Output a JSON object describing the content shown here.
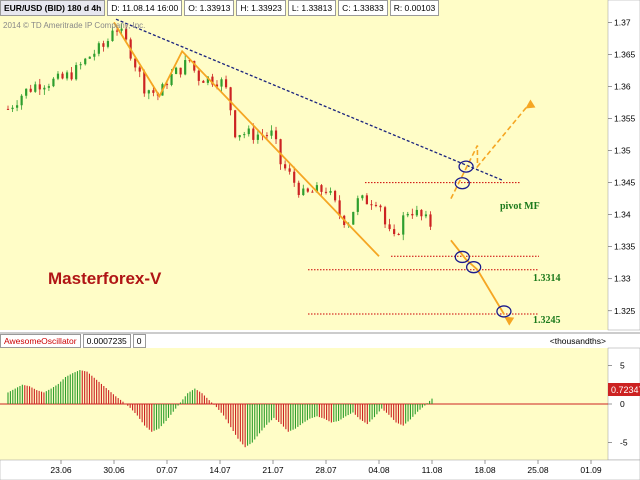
{
  "header": {
    "symbol": "EUR/USD (BID) 180 d 4h",
    "date": "D: 11.08.14 16:00",
    "open": "O: 1.33913",
    "high": "H: 1.33923",
    "low": "L: 1.33813",
    "close": "C: 1.33833",
    "range": "R: 0.00103"
  },
  "copyright": "2014 © TD Ameritrade IP Company, Inc.",
  "watermark": "Masterforex-V",
  "annotations": {
    "pivot": "pivot MF",
    "level1": "1.3314",
    "level2": "1.3245"
  },
  "colors": {
    "background": "#fffdc7",
    "bull_candle": "#2e9e2e",
    "bear_candle": "#cc2222",
    "trendline_blue": "#1a237e",
    "trend_orange": "#f5a623",
    "level_line": "#cc0000",
    "circle": "#1a1a8c",
    "watermark": "#b01515",
    "annotation_green": "#1c7a1c"
  },
  "oscillator": {
    "name": "AwesomeOscillator",
    "value": "0.0007235",
    "param": "0",
    "units": "<thousandths>",
    "current_label": "0.72347"
  },
  "chart_data": [
    {
      "type": "candlestick",
      "title": "EUR/USD (BID) 180 d 4h",
      "x": [
        "23.06",
        "30.06",
        "07.07",
        "14.07",
        "21.07",
        "28.07",
        "04.08",
        "11.08",
        "18.08",
        "25.08",
        "01.09"
      ],
      "ylim": [
        1.322,
        1.371
      ],
      "yticks": [
        "1.37",
        "1.365",
        "1.36",
        "1.355",
        "1.35",
        "1.345",
        "1.34",
        "1.335",
        "1.33",
        "1.325"
      ],
      "series": [
        {
          "kind": "close path",
          "points": [
            [
              "16.06",
              1.3565
            ],
            [
              "18.06",
              1.359
            ],
            [
              "20.06",
              1.3605
            ],
            [
              "23.06",
              1.361
            ],
            [
              "25.06",
              1.3625
            ],
            [
              "27.06",
              1.365
            ],
            [
              "29.06",
              1.3665
            ],
            [
              "30.06",
              1.37
            ],
            [
              "02.07",
              1.366
            ],
            [
              "04.07",
              1.36
            ],
            [
              "06.07",
              1.3585
            ],
            [
              "07.07",
              1.361
            ],
            [
              "09.07",
              1.363
            ],
            [
              "10.07",
              1.364
            ],
            [
              "11.07",
              1.3615
            ],
            [
              "14.07",
              1.361
            ],
            [
              "15.07",
              1.359
            ],
            [
              "16.07",
              1.353
            ],
            [
              "18.07",
              1.3525
            ],
            [
              "21.07",
              1.3525
            ],
            [
              "22.07",
              1.348
            ],
            [
              "23.07",
              1.3465
            ],
            [
              "25.07",
              1.343
            ],
            [
              "28.07",
              1.344
            ],
            [
              "29.07",
              1.342
            ],
            [
              "30.07",
              1.3395
            ],
            [
              "31.07",
              1.339
            ],
            [
              "01.08",
              1.342
            ],
            [
              "04.08",
              1.3425
            ],
            [
              "05.08",
              1.3375
            ],
            [
              "06.08",
              1.336
            ],
            [
              "07.08",
              1.339
            ],
            [
              "08.08",
              1.341
            ],
            [
              "11.08",
              1.3383
            ]
          ]
        }
      ],
      "levels": [
        {
          "value": 1.345,
          "label": "pivot MF"
        },
        {
          "value": 1.3314,
          "label": "1.3314"
        },
        {
          "value": 1.3245,
          "label": "1.3245"
        }
      ],
      "annotations": [
        "Masterforex-V",
        "pivot MF",
        "1.3314",
        "1.3245"
      ]
    },
    {
      "type": "bar",
      "title": "AwesomeOscillator",
      "ylim": [
        -7,
        7
      ],
      "yticks": [
        "5",
        "0",
        "-5"
      ],
      "current": 0.72347,
      "series": [
        {
          "name": "AwesomeOscillator",
          "values": [
            1.5,
            2.0,
            2.5,
            2.3,
            1.8,
            1.5,
            2.0,
            2.6,
            3.5,
            4.0,
            4.4,
            4.2,
            3.4,
            2.6,
            1.8,
            1.0,
            0.3,
            -0.5,
            -1.5,
            -2.8,
            -3.6,
            -3.2,
            -2.2,
            -1.0,
            0.2,
            1.4,
            2.0,
            1.4,
            0.5,
            -0.4,
            -1.5,
            -3.0,
            -4.5,
            -5.6,
            -5.0,
            -3.8,
            -2.7,
            -1.8,
            -2.6,
            -3.6,
            -3.2,
            -2.5,
            -1.9,
            -1.6,
            -1.9,
            -2.4,
            -2.2,
            -1.6,
            -1.1,
            -2.0,
            -2.6,
            -1.7,
            -0.6,
            -1.4,
            -2.4,
            -2.8,
            -2.0,
            -1.0,
            -0.2,
            0.7
          ]
        }
      ]
    }
  ]
}
